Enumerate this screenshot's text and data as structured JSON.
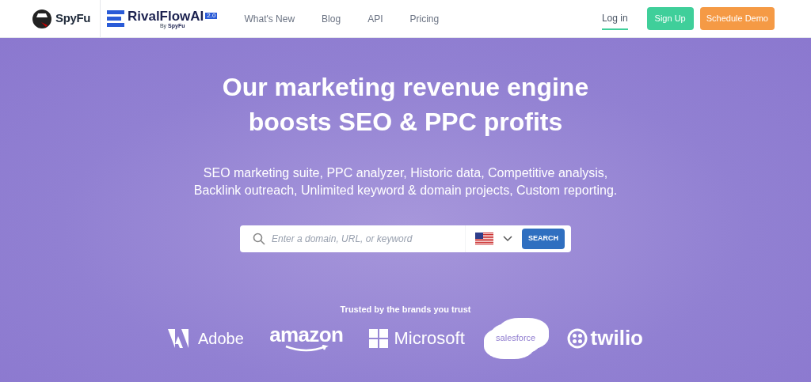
{
  "header": {
    "logo": "SpyFu",
    "product": {
      "name": "RivalFlowAI",
      "version": "2.0",
      "byline": "By",
      "byline_brand": "SpyFu"
    },
    "nav": [
      "What's New",
      "Blog",
      "API",
      "Pricing"
    ],
    "login": "Log in",
    "signup": "Sign Up",
    "demo": "Schedule Demo"
  },
  "hero": {
    "title_lines": [
      "Our marketing revenue engine",
      "boosts SEO & PPC profits"
    ],
    "subtitle": "SEO marketing suite, PPC analyzer, Historic data, Competitive analysis, Backlink outreach, Unlimited keyword & domain projects, Custom reporting.",
    "search": {
      "placeholder": "Enter a domain, URL, or keyword",
      "button": "SEARCH"
    }
  },
  "brands": {
    "heading": "Trusted by the brands you trust",
    "items": [
      {
        "kind": "adobe",
        "name": "Adobe"
      },
      {
        "kind": "amazon",
        "name": "amazon"
      },
      {
        "kind": "microsoft",
        "name": "Microsoft"
      },
      {
        "kind": "salesforce",
        "name": "salesforce"
      },
      {
        "kind": "twilio",
        "name": "twilio"
      }
    ]
  }
}
